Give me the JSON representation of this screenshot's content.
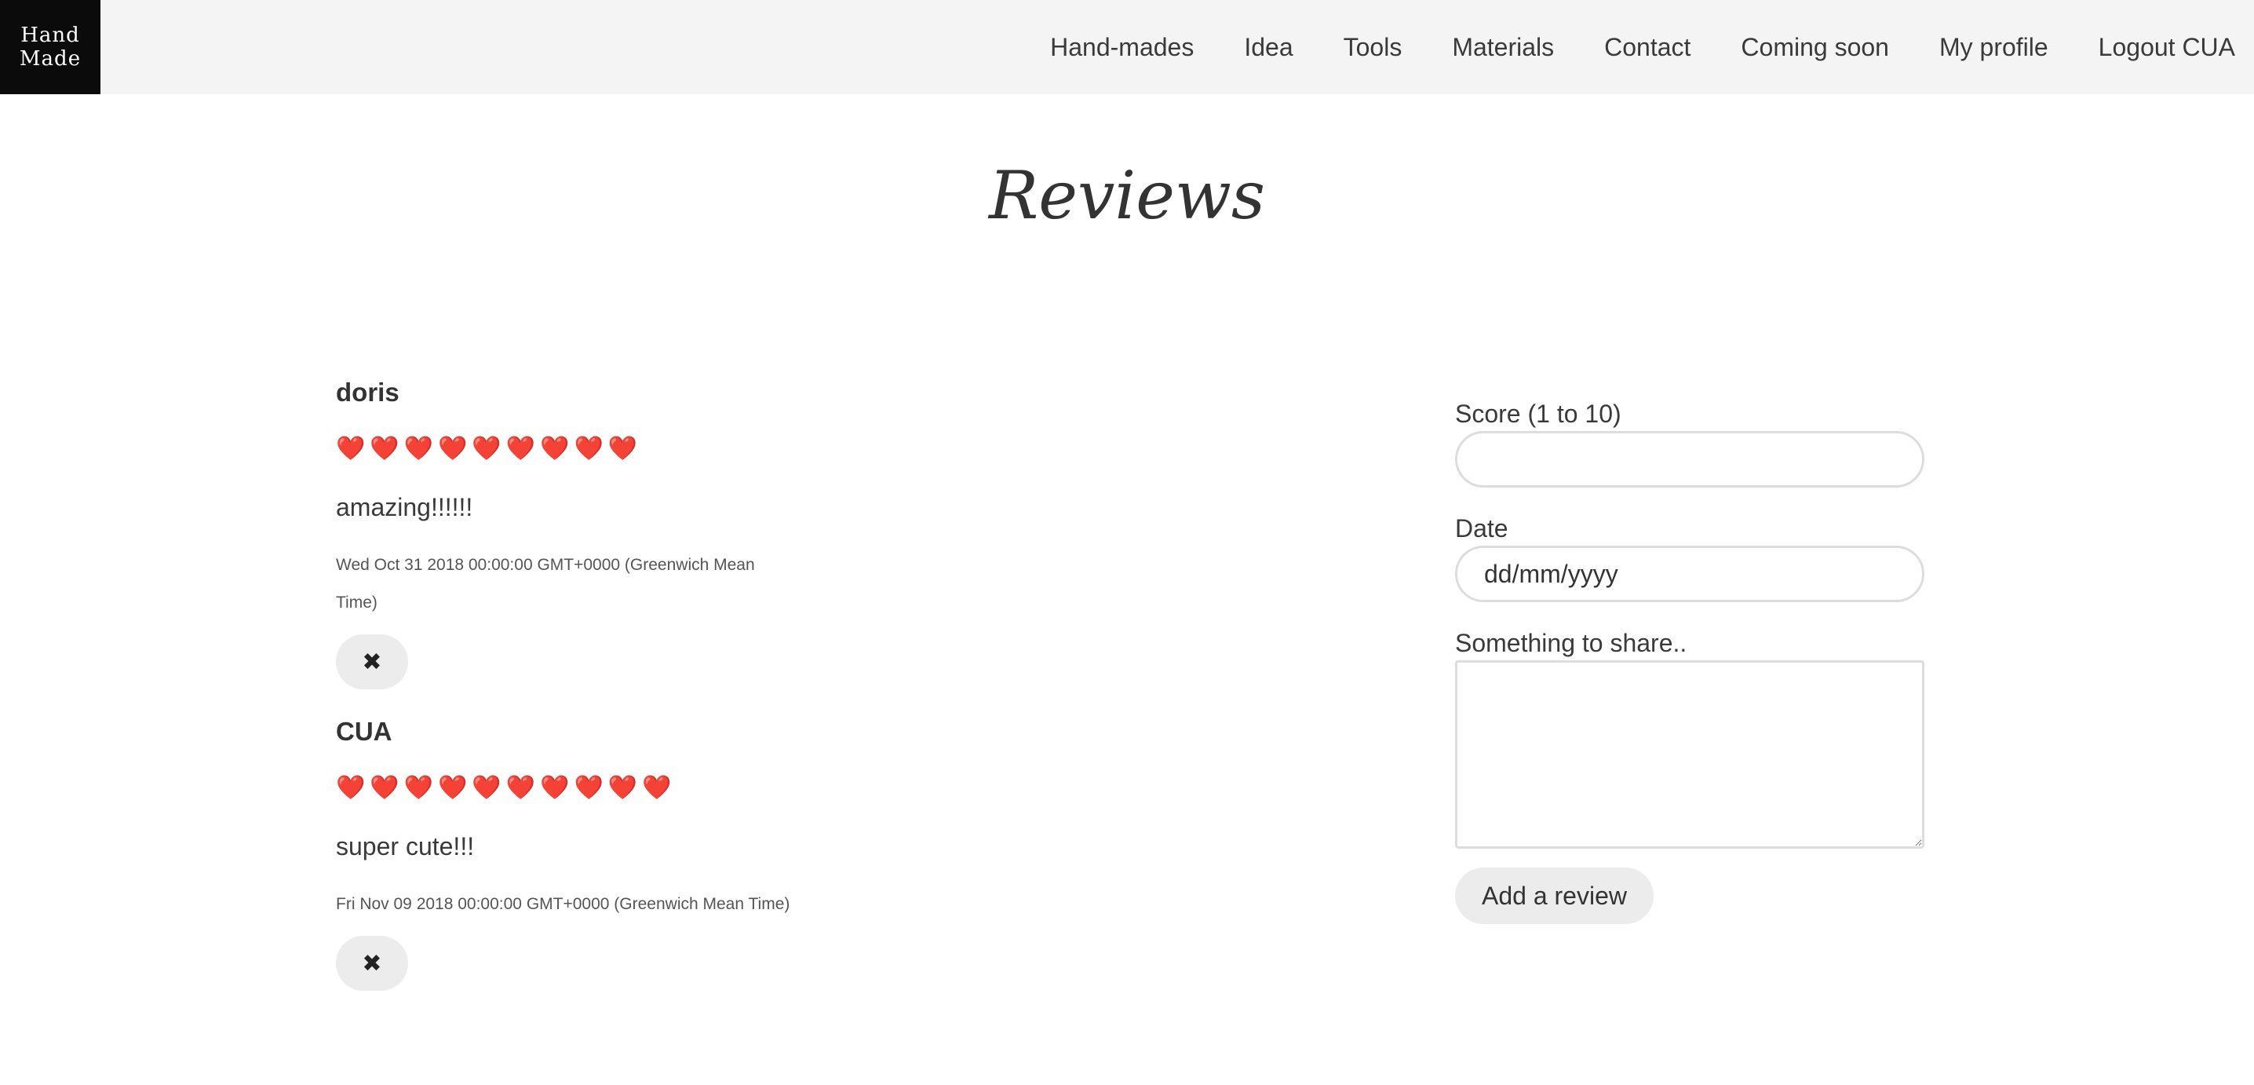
{
  "navbar": {
    "logo_line1": "Hand",
    "logo_line2": "Made",
    "links": [
      "Hand-mades",
      "Idea",
      "Tools",
      "Materials",
      "Contact",
      "Coming soon",
      "My profile",
      "Logout CUA"
    ]
  },
  "page": {
    "title": "Reviews"
  },
  "reviews": [
    {
      "author": "doris",
      "score": 9,
      "score_display": "❤️❤️❤️❤️❤️❤️❤️❤️❤️",
      "comment": "amazing!!!!!!",
      "date": "Wed Oct 31 2018 00:00:00 GMT+0000 (Greenwich Mean Time)",
      "delete_icon": "✖"
    },
    {
      "author": "CUA",
      "score": 10,
      "score_display": "❤️❤️❤️❤️❤️❤️❤️❤️❤️❤️",
      "comment": "super cute!!!",
      "date": "Fri Nov 09 2018 00:00:00 GMT+0000 (Greenwich Mean Time)",
      "delete_icon": "✖"
    }
  ],
  "form": {
    "score_label": "Score (1 to 10)",
    "score_value": "",
    "date_label": "Date",
    "date_placeholder": "dd/mm/yyyy",
    "share_label": "Something to share..",
    "share_value": "",
    "submit_label": "Add a review"
  },
  "colors": {
    "navbar_bg": "#f4f4f4",
    "logo_bg": "#0b0b0b",
    "heart": "#e3262c",
    "button_bg": "#ececec"
  }
}
